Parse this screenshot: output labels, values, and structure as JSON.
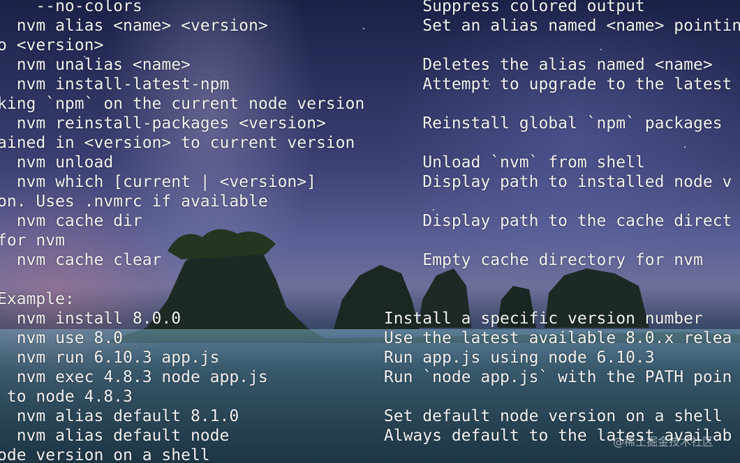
{
  "terminal": {
    "lines": [
      "    --no-colors                             Suppress colored output",
      "  nvm alias <name> <version>                Set an alias named <name> pointing",
      "o <version>",
      "  nvm unalias <name>                        Deletes the alias named <name>",
      "  nvm install-latest-npm                    Attempt to upgrade to the latest",
      "king `npm` on the current node version",
      "  nvm reinstall-packages <version>          Reinstall global `npm` packages",
      "ained in <version> to current version",
      "  nvm unload                                Unload `nvm` from shell",
      "  nvm which [current | <version>]           Display path to installed node v",
      "on. Uses .nvmrc if available",
      "  nvm cache dir                             Display path to the cache direct",
      "for nvm",
      "  nvm cache clear                           Empty cache directory for nvm",
      "",
      "Example:",
      "  nvm install 8.0.0                     Install a specific version number",
      "  nvm use 8.0                           Use the latest available 8.0.x relea",
      "  nvm run 6.10.3 app.js                 Run app.js using node 6.10.3",
      "  nvm exec 4.8.3 node app.js            Run `node app.js` with the PATH poin",
      " to node 4.8.3",
      "  nvm alias default 8.1.0               Set default node version on a shell",
      "  nvm alias default node                Always default to the latest availab",
      "ode version on a shell"
    ]
  },
  "watermark": "@稀土掘金技术社区"
}
